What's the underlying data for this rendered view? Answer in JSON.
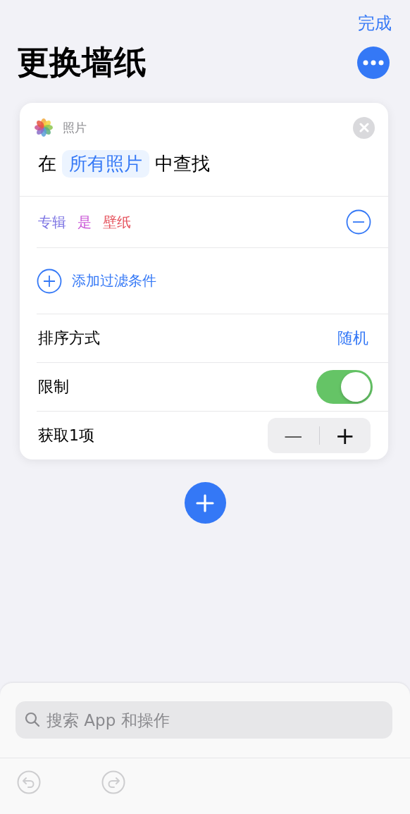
{
  "nav": {
    "done": "完成"
  },
  "title": "更换墙纸",
  "action": {
    "app": "照片",
    "prefix": "在",
    "scope": "所有照片",
    "suffix": "中查找",
    "filters": [
      {
        "tokens": [
          {
            "text": "专辑",
            "color": "#7b73e3"
          },
          {
            "text": "是",
            "color": "#c957d6"
          },
          {
            "text": "壁纸",
            "color": "#e5535d"
          }
        ]
      }
    ],
    "add_filter": "添加过滤条件",
    "rows": [
      {
        "kind": "value",
        "label": "排序方式",
        "value": "随机"
      },
      {
        "kind": "toggle",
        "label": "限制",
        "on": true
      },
      {
        "kind": "stepper",
        "label": "获取1项",
        "minus": "—",
        "plus": "+"
      }
    ]
  },
  "search": {
    "placeholder": "搜索 App 和操作"
  },
  "toolbar": {
    "undo_disabled": true,
    "redo_disabled": true
  }
}
